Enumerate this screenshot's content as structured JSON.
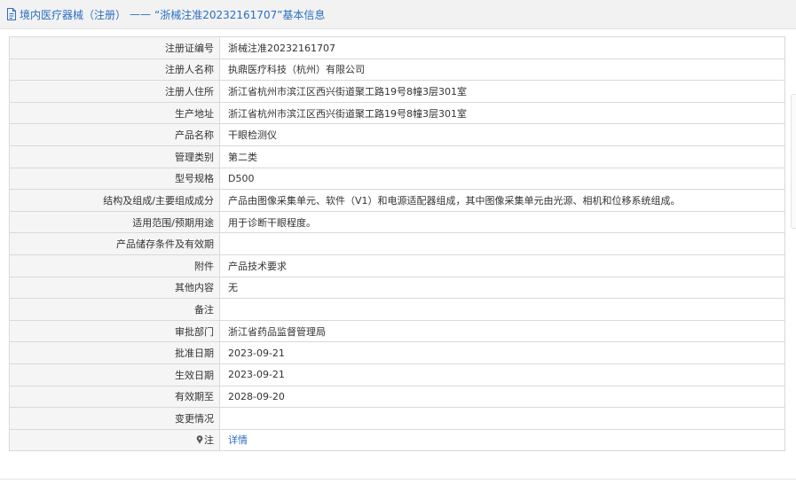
{
  "header": {
    "part1": "境内医疗器械（注册）",
    "separator": "——",
    "part2": "“浙械注准20232161707”基本信息",
    "color": "#2a6fc1"
  },
  "rows": [
    {
      "label": "注册证编号",
      "value": "浙械注准20232161707"
    },
    {
      "label": "注册人名称",
      "value": "执鼎医疗科技（杭州）有限公司"
    },
    {
      "label": "注册人住所",
      "value": "浙江省杭州市滨江区西兴街道聚工路19号8幢3层301室"
    },
    {
      "label": "生产地址",
      "value": "浙江省杭州市滨江区西兴街道聚工路19号8幢3层301室"
    },
    {
      "label": "产品名称",
      "value": "干眼检测仪"
    },
    {
      "label": "管理类别",
      "value": "第二类"
    },
    {
      "label": "型号规格",
      "value": "D500"
    },
    {
      "label": "结构及组成/主要组成成分",
      "value": "产品由图像采集单元、软件（V1）和电源适配器组成，其中图像采集单元由光源、相机和位移系统组成。"
    },
    {
      "label": "适用范围/预期用途",
      "value": "用于诊断干眼程度。"
    },
    {
      "label": "产品储存条件及有效期",
      "value": ""
    },
    {
      "label": "附件",
      "value": "产品技术要求"
    },
    {
      "label": "其他内容",
      "value": "无"
    },
    {
      "label": "备注",
      "value": ""
    },
    {
      "label": "审批部门",
      "value": "浙江省药品监督管理局"
    },
    {
      "label": "批准日期",
      "value": "2023-09-21"
    },
    {
      "label": "生效日期",
      "value": "2023-09-21"
    },
    {
      "label": "有效期至",
      "value": "2028-09-20"
    },
    {
      "label": "变更情况",
      "value": ""
    }
  ],
  "note_row": {
    "label": "注",
    "icon": "pin-icon",
    "link_text": "详情"
  }
}
